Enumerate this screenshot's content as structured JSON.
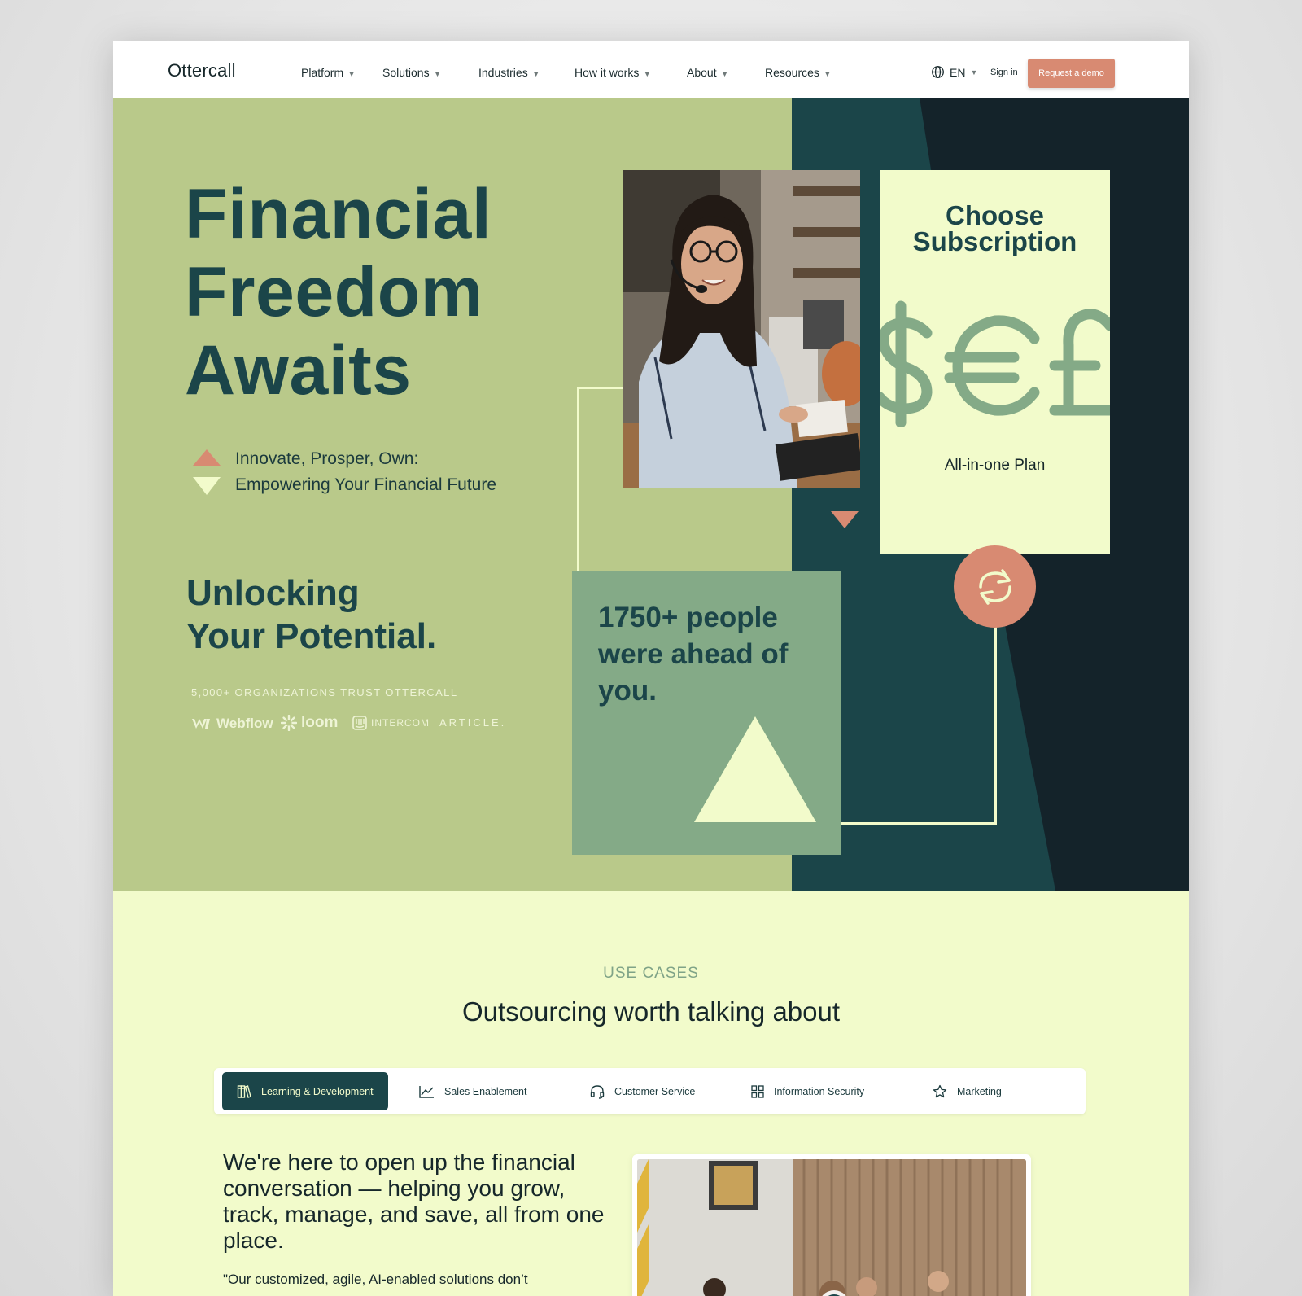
{
  "header": {
    "logo": "Ottercall",
    "nav": [
      "Platform",
      "Solutions",
      "Industries",
      "How it works",
      "About",
      "Resources"
    ],
    "language": "EN",
    "sign_in": "Sign in",
    "cta": "Request a demo"
  },
  "hero": {
    "title_lines": [
      "Financial",
      "Freedom",
      "Awaits"
    ],
    "tagline_lines": [
      "Innovate, Prosper, Own:",
      "Empowering Your Financial Future"
    ],
    "subtitle_lines": [
      "Unlocking",
      "Your Potential."
    ],
    "trust_text": "5,000+ ORGANIZATIONS TRUST OTTERCALL",
    "partners": [
      "Webflow",
      "loom",
      "INTERCOM",
      "ARTICLE."
    ],
    "card": {
      "title_lines": [
        "Choose",
        "Subscription"
      ],
      "currency_symbols": "$€£",
      "plan": "All-in-one Plan"
    },
    "stat_lines": [
      "1750+ people",
      "were ahead of",
      "you."
    ]
  },
  "use_cases": {
    "label": "USE CASES",
    "title": "Outsourcing worth talking about",
    "tabs": [
      {
        "label": "Learning & Development",
        "icon": "books-icon",
        "active": true
      },
      {
        "label": "Sales Enablement",
        "icon": "line-chart-icon",
        "active": false
      },
      {
        "label": "Customer Service",
        "icon": "headset-icon",
        "active": false
      },
      {
        "label": "Information Security",
        "icon": "grid-icon",
        "active": false
      },
      {
        "label": "Marketing",
        "icon": "star-icon",
        "active": false
      }
    ],
    "heading": "We're here to open up the financial conversation — helping you grow, track, manage, and save, all from one place.",
    "quote": "\"Our customized, agile, AI-enabled solutions don’t"
  },
  "colors": {
    "hero_green": "#b9c98a",
    "dark_teal": "#1b4549",
    "cream": "#f2fbcb",
    "accent_coral": "#d88a72",
    "sage": "#84aa87"
  }
}
